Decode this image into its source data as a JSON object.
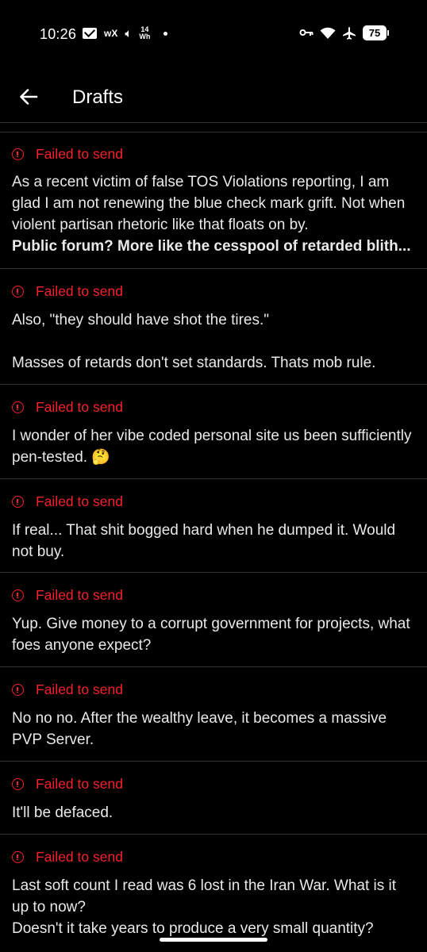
{
  "status_bar": {
    "time": "10:26",
    "wx": "wX",
    "wh_top": "14",
    "wh_bottom": "Wh",
    "battery": "75"
  },
  "header": {
    "title": "Drafts"
  },
  "drafts": [
    {
      "status": "Failed to send",
      "lines": [
        "As a recent victim of false TOS Violations reporting, I am glad I am not renewing the blue check mark grift. Not when violent partisan rhetoric like that floats on by."
      ],
      "bold_line": "Public forum? More like the cesspool of retarded blith..."
    },
    {
      "status": "Failed to send",
      "lines": [
        "Also, \"they should have shot the tires.\""
      ],
      "line2": "Masses of retards don't set standards. Thats mob rule."
    },
    {
      "status": "Failed to send",
      "lines": [
        "I wonder of her vibe coded personal site us been sufficiently pen-tested. 🤔"
      ]
    },
    {
      "status": "Failed to send",
      "lines": [
        "If real... That shit bogged hard when he dumped it. Would not buy."
      ]
    },
    {
      "status": "Failed to send",
      "lines": [
        "Yup. Give money to a corrupt government for projects, what foes anyone expect?"
      ]
    },
    {
      "status": "Failed to send",
      "lines": [
        "No no no. After the wealthy leave, it becomes a massive PVP Server."
      ]
    },
    {
      "status": "Failed to send",
      "lines": [
        "It'll be defaced."
      ]
    },
    {
      "status": "Failed to send",
      "lines": [
        "Last soft count I read was 6 lost in the Iran War. What is it up to now?"
      ],
      "line2": "Doesn't it take years to produce a very small quantity?"
    }
  ]
}
